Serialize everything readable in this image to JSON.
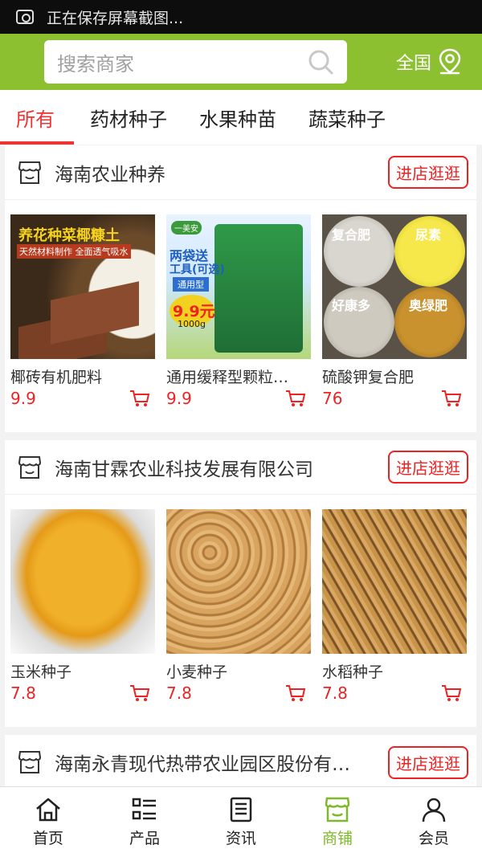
{
  "status_bar": {
    "notification": "正在保存屏幕截图..."
  },
  "search": {
    "placeholder": "搜索商家"
  },
  "region": {
    "label": "全国"
  },
  "tabs": [
    "所有",
    "药材种子",
    "水果种苗",
    "蔬菜种子"
  ],
  "enter_store_label": "进店逛逛",
  "stores": [
    {
      "name": "海南农业种养",
      "products": [
        {
          "name": "椰砖有机肥料",
          "price": "9.9",
          "image_text": [
            "养花种菜椰糠土",
            "天然材料制作 全面透气吸水"
          ]
        },
        {
          "name": "通用缓释型颗粒…",
          "price": "9.9",
          "image_text": [
            "两袋送",
            "工具(可选)",
            "通用型",
            "9.9元",
            "1000g",
            "一美安"
          ]
        },
        {
          "name": "硫酸钾复合肥",
          "price": "76",
          "image_text": [
            "复合肥",
            "尿素",
            "好康多",
            "奥绿肥"
          ]
        }
      ]
    },
    {
      "name": "海南甘霖农业科技发展有限公司",
      "products": [
        {
          "name": "玉米种子",
          "price": "7.8"
        },
        {
          "name": "小麦种子",
          "price": "7.8"
        },
        {
          "name": "水稻种子",
          "price": "7.8"
        }
      ]
    },
    {
      "name": "海南永青现代热带农业园区股份有…"
    }
  ],
  "bottom_nav": [
    {
      "label": "首页",
      "icon": "home-icon"
    },
    {
      "label": "产品",
      "icon": "list-icon"
    },
    {
      "label": "资讯",
      "icon": "news-icon"
    },
    {
      "label": "商铺",
      "icon": "shop-icon",
      "active": true
    },
    {
      "label": "会员",
      "icon": "user-icon"
    }
  ],
  "colors": {
    "brand_green": "#8cc030",
    "accent_red": "#e22222",
    "nav_active": "#7fb82a"
  }
}
